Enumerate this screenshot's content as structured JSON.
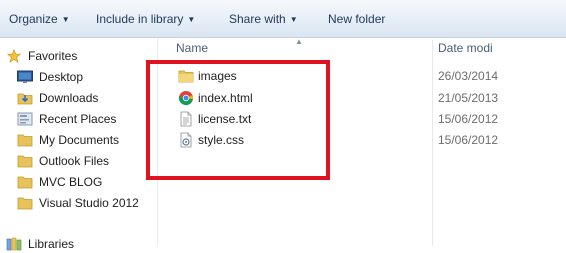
{
  "toolbar": {
    "organize": "Organize",
    "include_in_library": "Include in library",
    "share_with": "Share with",
    "new_folder": "New folder"
  },
  "nav": {
    "favorites": "Favorites",
    "items": [
      {
        "label": "Desktop",
        "icon": "desktop-icon"
      },
      {
        "label": "Downloads",
        "icon": "downloads-folder-icon"
      },
      {
        "label": "Recent Places",
        "icon": "recent-places-icon"
      },
      {
        "label": "My Documents",
        "icon": "folder-icon"
      },
      {
        "label": "Outlook Files",
        "icon": "folder-icon"
      },
      {
        "label": "MVC BLOG",
        "icon": "folder-icon"
      },
      {
        "label": "Visual Studio 2012",
        "icon": "folder-icon"
      }
    ],
    "libraries": "Libraries"
  },
  "columns": {
    "name": "Name",
    "date_modified": "Date modi"
  },
  "files": [
    {
      "name": "images",
      "date": "26/03/2014",
      "icon": "folder-icon"
    },
    {
      "name": "index.html",
      "date": "21/05/2013",
      "icon": "chrome-html-icon"
    },
    {
      "name": "license.txt",
      "date": "15/06/2012",
      "icon": "text-file-icon"
    },
    {
      "name": "style.css",
      "date": "15/06/2012",
      "icon": "css-file-icon"
    }
  ],
  "colors": {
    "highlight": "#e0121f",
    "toolbar_text": "#1e395b",
    "folder": "#e8c25a"
  }
}
